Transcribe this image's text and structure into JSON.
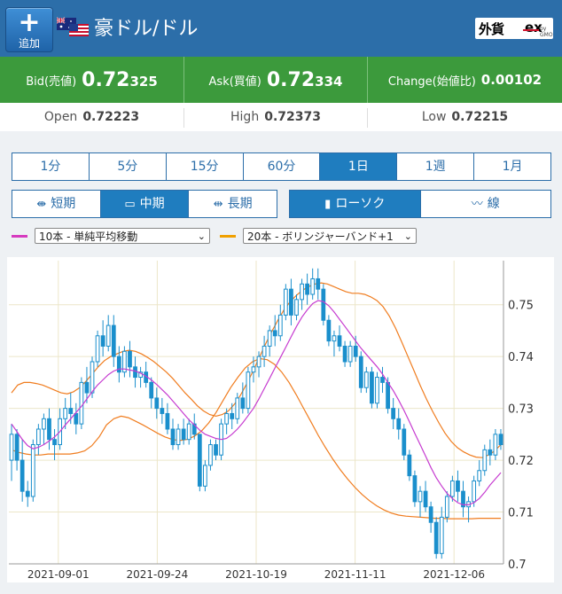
{
  "header": {
    "add_label": "追加",
    "title": "豪ドル/ドル",
    "brand_a": "外貨",
    "brand_b": "ex",
    "brand_c": "by GMO"
  },
  "quotes": {
    "bid_label": "Bid(売値)",
    "bid_lead": "0.72",
    "bid_tail": "325",
    "ask_label": "Ask(買値)",
    "ask_lead": "0.72",
    "ask_tail": "334",
    "change_label": "Change(始値比)",
    "change_value": "0.00102",
    "open_label": "Open",
    "open_value": "0.72223",
    "high_label": "High",
    "high_value": "0.72373",
    "low_label": "Low",
    "low_value": "0.72215"
  },
  "timeframes": [
    "1分",
    "5分",
    "15分",
    "60分",
    "1日",
    "1週",
    "1月"
  ],
  "timeframe_selected": "1日",
  "periods": [
    "短期",
    "中期",
    "長期"
  ],
  "period_selected": "中期",
  "chart_types": [
    "ローソク",
    "線"
  ],
  "chart_type_selected": "ローソク",
  "indicators": [
    {
      "value": "10本 - 単純平均移動",
      "color": "#d63bbf"
    },
    {
      "value": "20本 - ボリンジャーバンド+1",
      "color": "#f0a000"
    }
  ],
  "colors": {
    "candle": "#1a8fcc",
    "ma": "#c63bd0",
    "band": "#f07c1e",
    "header": "#2c6ea9",
    "quote_bg": "#3c9a3c"
  },
  "chart_data": {
    "type": "candlestick",
    "y_ticks": [
      "0.75",
      "0.74",
      "0.73",
      "0.72",
      "0.71",
      "0.7"
    ],
    "x_ticks": [
      "2021-09-01",
      "2021-09-24",
      "2021-10-19",
      "2021-11-11",
      "2021-12-06"
    ],
    "ylim": [
      0.7,
      0.7585
    ],
    "grid": true,
    "candles": [
      [
        0.72,
        0.727,
        0.716,
        0.725
      ],
      [
        0.725,
        0.726,
        0.718,
        0.72
      ],
      [
        0.72,
        0.724,
        0.712,
        0.714
      ],
      [
        0.714,
        0.716,
        0.711,
        0.713
      ],
      [
        0.713,
        0.724,
        0.712,
        0.723
      ],
      [
        0.723,
        0.727,
        0.721,
        0.726
      ],
      [
        0.726,
        0.729,
        0.723,
        0.728
      ],
      [
        0.728,
        0.73,
        0.722,
        0.724
      ],
      [
        0.724,
        0.726,
        0.72,
        0.723
      ],
      [
        0.723,
        0.73,
        0.722,
        0.728
      ],
      [
        0.728,
        0.732,
        0.726,
        0.73
      ],
      [
        0.73,
        0.733,
        0.727,
        0.729
      ],
      [
        0.729,
        0.731,
        0.725,
        0.727
      ],
      [
        0.727,
        0.736,
        0.726,
        0.735
      ],
      [
        0.735,
        0.738,
        0.731,
        0.733
      ],
      [
        0.733,
        0.74,
        0.732,
        0.739
      ],
      [
        0.739,
        0.745,
        0.738,
        0.744
      ],
      [
        0.744,
        0.747,
        0.74,
        0.742
      ],
      [
        0.742,
        0.748,
        0.741,
        0.746
      ],
      [
        0.746,
        0.748,
        0.738,
        0.74
      ],
      [
        0.74,
        0.742,
        0.735,
        0.737
      ],
      [
        0.737,
        0.742,
        0.736,
        0.741
      ],
      [
        0.741,
        0.743,
        0.736,
        0.738
      ],
      [
        0.738,
        0.74,
        0.734,
        0.736
      ],
      [
        0.736,
        0.738,
        0.734,
        0.737
      ],
      [
        0.737,
        0.739,
        0.734,
        0.735
      ],
      [
        0.735,
        0.736,
        0.73,
        0.732
      ],
      [
        0.732,
        0.734,
        0.728,
        0.73
      ],
      [
        0.73,
        0.732,
        0.727,
        0.729
      ],
      [
        0.729,
        0.731,
        0.725,
        0.726
      ],
      [
        0.726,
        0.728,
        0.722,
        0.723
      ],
      [
        0.723,
        0.727,
        0.722,
        0.726
      ],
      [
        0.726,
        0.728,
        0.723,
        0.724
      ],
      [
        0.724,
        0.728,
        0.723,
        0.727
      ],
      [
        0.727,
        0.729,
        0.724,
        0.725
      ],
      [
        0.725,
        0.725,
        0.714,
        0.715
      ],
      [
        0.715,
        0.72,
        0.714,
        0.719
      ],
      [
        0.719,
        0.724,
        0.718,
        0.723
      ],
      [
        0.723,
        0.724,
        0.72,
        0.721
      ],
      [
        0.721,
        0.728,
        0.72,
        0.727
      ],
      [
        0.727,
        0.73,
        0.725,
        0.729
      ],
      [
        0.729,
        0.731,
        0.726,
        0.728
      ],
      [
        0.728,
        0.733,
        0.727,
        0.732
      ],
      [
        0.732,
        0.735,
        0.729,
        0.73
      ],
      [
        0.73,
        0.738,
        0.729,
        0.737
      ],
      [
        0.737,
        0.74,
        0.735,
        0.738
      ],
      [
        0.738,
        0.741,
        0.736,
        0.74
      ],
      [
        0.74,
        0.744,
        0.738,
        0.742
      ],
      [
        0.742,
        0.746,
        0.74,
        0.745
      ],
      [
        0.745,
        0.748,
        0.742,
        0.744
      ],
      [
        0.744,
        0.75,
        0.743,
        0.748
      ],
      [
        0.748,
        0.754,
        0.747,
        0.753
      ],
      [
        0.753,
        0.755,
        0.746,
        0.748
      ],
      [
        0.748,
        0.752,
        0.747,
        0.751
      ],
      [
        0.751,
        0.755,
        0.749,
        0.754
      ],
      [
        0.754,
        0.756,
        0.75,
        0.752
      ],
      [
        0.752,
        0.757,
        0.751,
        0.755
      ],
      [
        0.755,
        0.757,
        0.751,
        0.753
      ],
      [
        0.753,
        0.754,
        0.746,
        0.747
      ],
      [
        0.747,
        0.748,
        0.742,
        0.743
      ],
      [
        0.743,
        0.745,
        0.74,
        0.744
      ],
      [
        0.744,
        0.746,
        0.741,
        0.742
      ],
      [
        0.742,
        0.743,
        0.738,
        0.739
      ],
      [
        0.739,
        0.743,
        0.738,
        0.742
      ],
      [
        0.742,
        0.744,
        0.739,
        0.74
      ],
      [
        0.74,
        0.741,
        0.733,
        0.734
      ],
      [
        0.734,
        0.738,
        0.733,
        0.737
      ],
      [
        0.737,
        0.738,
        0.73,
        0.731
      ],
      [
        0.731,
        0.737,
        0.73,
        0.736
      ],
      [
        0.736,
        0.738,
        0.733,
        0.735
      ],
      [
        0.735,
        0.736,
        0.729,
        0.73
      ],
      [
        0.73,
        0.732,
        0.726,
        0.728
      ],
      [
        0.728,
        0.73,
        0.724,
        0.726
      ],
      [
        0.726,
        0.727,
        0.72,
        0.721
      ],
      [
        0.721,
        0.722,
        0.716,
        0.717
      ],
      [
        0.717,
        0.718,
        0.711,
        0.712
      ],
      [
        0.712,
        0.715,
        0.709,
        0.714
      ],
      [
        0.714,
        0.716,
        0.71,
        0.711
      ],
      [
        0.711,
        0.712,
        0.706,
        0.708
      ],
      [
        0.708,
        0.709,
        0.701,
        0.702
      ],
      [
        0.702,
        0.711,
        0.701,
        0.709
      ],
      [
        0.709,
        0.714,
        0.708,
        0.713
      ],
      [
        0.713,
        0.717,
        0.712,
        0.716
      ],
      [
        0.716,
        0.718,
        0.712,
        0.714
      ],
      [
        0.714,
        0.716,
        0.709,
        0.711
      ],
      [
        0.711,
        0.713,
        0.708,
        0.712
      ],
      [
        0.712,
        0.717,
        0.711,
        0.716
      ],
      [
        0.716,
        0.72,
        0.715,
        0.718
      ],
      [
        0.718,
        0.723,
        0.717,
        0.722
      ],
      [
        0.722,
        0.724,
        0.719,
        0.721
      ],
      [
        0.721,
        0.726,
        0.72,
        0.725
      ],
      [
        0.725,
        0.726,
        0.722,
        0.723
      ]
    ],
    "ma10": [
      0.727,
      0.7255,
      0.724,
      0.7228,
      0.7222,
      0.7225,
      0.723,
      0.7237,
      0.7245,
      0.7255,
      0.7268,
      0.728,
      0.7292,
      0.7304,
      0.7318,
      0.7332,
      0.7345,
      0.7355,
      0.7365,
      0.7372,
      0.7376,
      0.7376,
      0.7374,
      0.7372,
      0.7368,
      0.7362,
      0.7355,
      0.7346,
      0.7336,
      0.7326,
      0.7314,
      0.7302,
      0.729,
      0.7278,
      0.7268,
      0.7258,
      0.725,
      0.7246,
      0.7242,
      0.724,
      0.7242,
      0.725,
      0.726,
      0.7272,
      0.7286,
      0.73,
      0.7318,
      0.7338,
      0.7358,
      0.7378,
      0.7398,
      0.7418,
      0.7438,
      0.7458,
      0.7476,
      0.749,
      0.7502,
      0.7508,
      0.7506,
      0.7498,
      0.7486,
      0.7472,
      0.7458,
      0.7444,
      0.743,
      0.7416,
      0.7404,
      0.7392,
      0.738,
      0.7366,
      0.735,
      0.7334,
      0.7316,
      0.7296,
      0.7274,
      0.7252,
      0.723,
      0.7208,
      0.7186,
      0.7166,
      0.715,
      0.7136,
      0.7126,
      0.7118,
      0.7114,
      0.7114,
      0.7118,
      0.7126,
      0.7138,
      0.7152,
      0.7164,
      0.7176
    ],
    "band_upper": [
      0.733,
      0.7345,
      0.735,
      0.735,
      0.7348,
      0.7345,
      0.734,
      0.7335,
      0.733,
      0.7328,
      0.7332,
      0.734,
      0.7352,
      0.7366,
      0.738,
      0.7392,
      0.74,
      0.7405,
      0.741,
      0.7412,
      0.741,
      0.7405,
      0.7398,
      0.739,
      0.738,
      0.737,
      0.7358,
      0.7344,
      0.733,
      0.7318,
      0.7305,
      0.7295,
      0.7288,
      0.7285,
      0.7288,
      0.7295,
      0.7308,
      0.7326,
      0.7348,
      0.7372,
      0.7398,
      0.7424,
      0.7448,
      0.747,
      0.749,
      0.7506,
      0.7518,
      0.7528,
      0.7535,
      0.754,
      0.7542,
      0.754,
      0.7535,
      0.753,
      0.7525,
      0.7522,
      0.7522,
      0.752,
      0.7515,
      0.7508,
      0.7496,
      0.7478,
      0.7455,
      0.7428,
      0.74,
      0.7372,
      0.7344,
      0.7318,
      0.7294,
      0.7272,
      0.7252,
      0.7236,
      0.7224,
      0.7216,
      0.721,
      0.7206,
      0.7205,
      0.721,
      0.7218,
      0.723
    ],
    "band_lower": [
      0.722,
      0.7215,
      0.7212,
      0.721,
      0.721,
      0.7212,
      0.7212,
      0.7212,
      0.7212,
      0.7214,
      0.7218,
      0.7228,
      0.7245,
      0.7268,
      0.728,
      0.7285,
      0.7282,
      0.7275,
      0.7268,
      0.726,
      0.7252,
      0.7245,
      0.724,
      0.7238,
      0.724,
      0.7246,
      0.7256,
      0.7272,
      0.7292,
      0.7316,
      0.734,
      0.736,
      0.7378,
      0.739,
      0.7396,
      0.7394,
      0.7385,
      0.737,
      0.735,
      0.7326,
      0.73,
      0.7274,
      0.7248,
      0.7224,
      0.7202,
      0.7182,
      0.7164,
      0.7148,
      0.7134,
      0.7122,
      0.7112,
      0.7104,
      0.7098,
      0.7094,
      0.7092,
      0.7091,
      0.709,
      0.7089,
      0.7088,
      0.7088,
      0.7087,
      0.7087,
      0.7087,
      0.7087,
      0.7088,
      0.7088,
      0.7088,
      0.7088
    ]
  }
}
